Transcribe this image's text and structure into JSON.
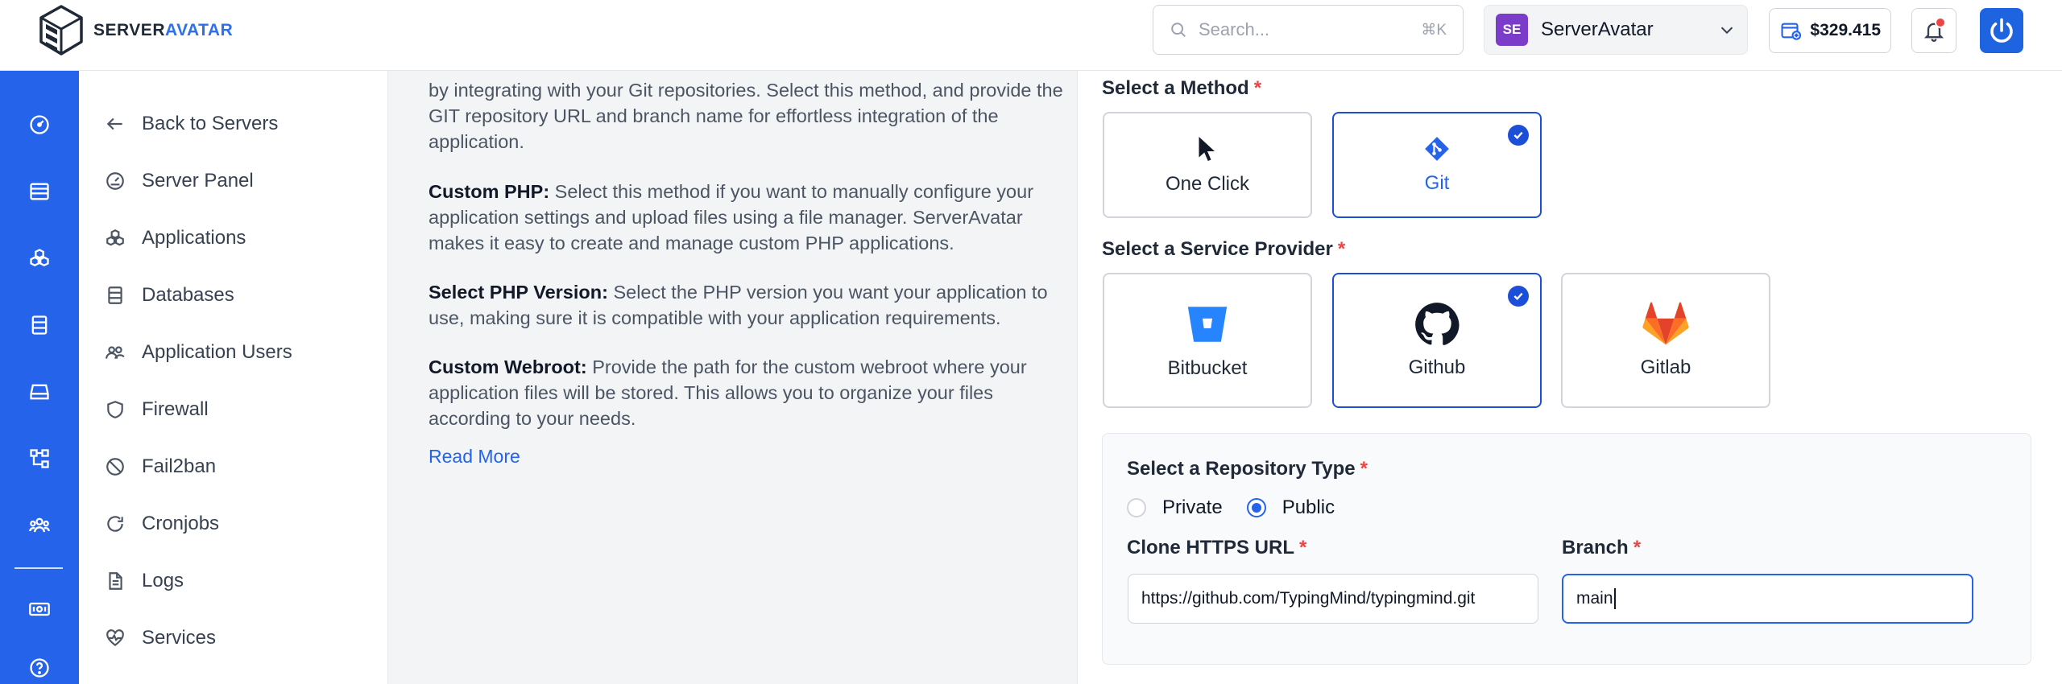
{
  "brand": {
    "part1": "SERVER",
    "part2": "AVATAR"
  },
  "search": {
    "placeholder": "Search...",
    "shortcut": "⌘K"
  },
  "workspace": {
    "initials": "SE",
    "name": "ServerAvatar"
  },
  "balance": {
    "amount": "$329.415"
  },
  "colors": {
    "accent": "#2563eb",
    "rail": "#2563eb",
    "required": "#ef4444",
    "workspace_badge": "#7a3cc9"
  },
  "rail": {
    "icons": [
      "dashboard-icon",
      "servers-icon",
      "applications-icon",
      "databases-icon",
      "storage-icon",
      "network-icon",
      "team-icon",
      "billing-icon",
      "help-icon"
    ]
  },
  "sidebar": {
    "items": [
      {
        "label": "Back to Servers",
        "icon": "arrow-left-icon"
      },
      {
        "label": "Server Panel",
        "icon": "gauge-icon"
      },
      {
        "label": "Applications",
        "icon": "cubes-icon"
      },
      {
        "label": "Databases",
        "icon": "database-icon"
      },
      {
        "label": "Application Users",
        "icon": "users-icon"
      },
      {
        "label": "Firewall",
        "icon": "shield-icon"
      },
      {
        "label": "Fail2ban",
        "icon": "ban-icon"
      },
      {
        "label": "Cronjobs",
        "icon": "refresh-icon"
      },
      {
        "label": "Logs",
        "icon": "document-icon"
      },
      {
        "label": "Services",
        "icon": "heartbeat-icon"
      }
    ]
  },
  "description": {
    "git_text": "by integrating with your Git repositories. Select this method, and provide the GIT repository URL and branch name for effortless integration of the application.",
    "custom_php_title": "Custom PHP:",
    "custom_php_text": " Select this method if you want to manually configure your application settings and upload files using a file manager. ServerAvatar makes it easy to create and manage custom PHP applications.",
    "php_version_title": "Select PHP Version:",
    "php_version_text": " Select the PHP version you want your application to use, making sure it is compatible with your application requirements.",
    "webroot_title": "Custom Webroot:",
    "webroot_text": " Provide the path for the custom webroot where your application files will be stored. This allows you to organize your files according to your needs.",
    "read_more": "Read More"
  },
  "form": {
    "method_label": "Select a Method",
    "methods": [
      {
        "label": "One Click",
        "selected": false
      },
      {
        "label": "Git",
        "selected": true
      }
    ],
    "provider_label": "Select a Service Provider",
    "providers": [
      {
        "label": "Bitbucket",
        "selected": false
      },
      {
        "label": "Github",
        "selected": true
      },
      {
        "label": "Gitlab",
        "selected": false
      }
    ],
    "repo_type_label": "Select a Repository Type",
    "repo_types": [
      {
        "label": "Private",
        "selected": false
      },
      {
        "label": "Public",
        "selected": true
      }
    ],
    "clone_url_label": "Clone HTTPS URL",
    "clone_url_value": "https://github.com/TypingMind/typingmind.git",
    "branch_label": "Branch",
    "branch_value": "main",
    "required_mark": "*"
  }
}
